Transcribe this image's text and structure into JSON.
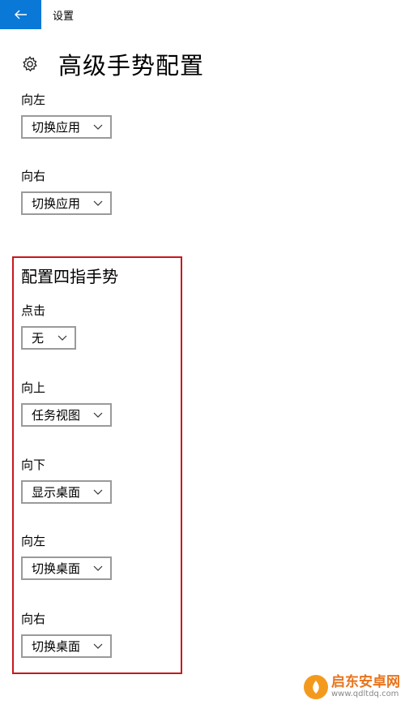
{
  "window": {
    "title": "设置"
  },
  "page": {
    "title": "高级手势配置"
  },
  "three_finger": {
    "items": [
      {
        "label": "向左",
        "value": "切换应用"
      },
      {
        "label": "向右",
        "value": "切换应用"
      }
    ]
  },
  "four_finger": {
    "title": "配置四指手势",
    "items": [
      {
        "label": "点击",
        "value": "无"
      },
      {
        "label": "向上",
        "value": "任务视图"
      },
      {
        "label": "向下",
        "value": "显示桌面"
      },
      {
        "label": "向左",
        "value": "切换桌面"
      },
      {
        "label": "向右",
        "value": "切换桌面"
      }
    ]
  },
  "watermark": {
    "name": "启东安卓网",
    "url": "www.qdltdq.com"
  },
  "colors": {
    "accent": "#0a78d7",
    "highlight_border": "#c8171e",
    "dropdown_border": "#9a9a9a"
  }
}
